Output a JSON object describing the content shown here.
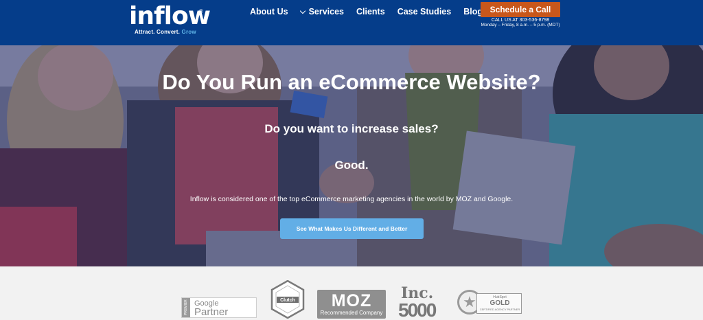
{
  "header": {
    "logo": {
      "word": "inflow",
      "tag_a": "Attract. Convert.",
      "tag_b": "Grow",
      "reg": "®"
    },
    "nav": [
      {
        "label": "About Us"
      },
      {
        "label": "Services"
      },
      {
        "label": "Clients"
      },
      {
        "label": "Case Studies"
      },
      {
        "label": "Blog"
      }
    ],
    "cta_label": "Schedule a Call",
    "call_line": "CALL US AT 303-536-8798",
    "hours_line": "Monday – Friday, 8 a.m. – 5 p.m. (MDT)"
  },
  "hero": {
    "title": "Do You Run an eCommerce Website?",
    "question": "Do you want to increase sales?",
    "answer": "Good.",
    "description": "Inflow is considered one of the top eCommerce marketing agencies in the world by MOZ and Google.",
    "button_label": "See What Makes Us Different and Better"
  },
  "badges": {
    "google": {
      "side": "PREMIER",
      "line1": "Google",
      "line2": "Partner"
    },
    "clutch": {
      "label": "Clutch"
    },
    "moz": {
      "line1": "MOZ",
      "line2": "Recommended Company"
    },
    "inc": {
      "line1": "Inc.",
      "line2": "5000"
    },
    "hubspot": {
      "line1": "HubSpot",
      "line2": "GOLD",
      "line3": "CERTIFIED AGENCY PARTNER"
    }
  },
  "colors": {
    "header_bg": "#053d8a",
    "cta": "#c8571b",
    "hero_button": "#62aee6",
    "logo_accent": "#5fb4e8"
  }
}
